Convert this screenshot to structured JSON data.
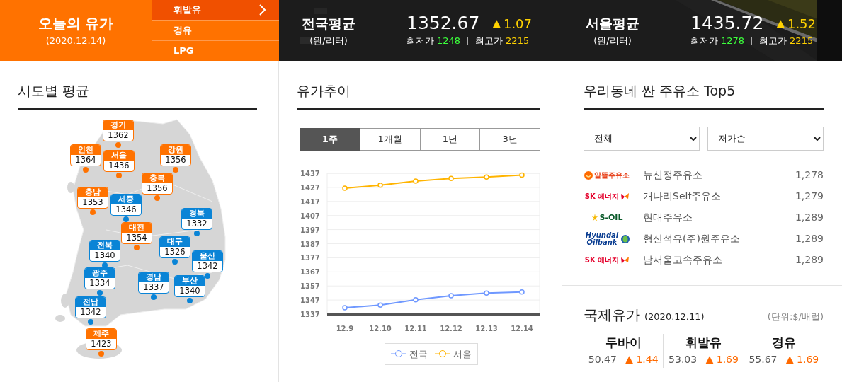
{
  "header": {
    "title": "오늘의 유가",
    "date": "(2020.12.14)",
    "fuels": [
      {
        "label": "휘발유",
        "selected": true
      },
      {
        "label": "경유",
        "selected": false
      },
      {
        "label": "LPG",
        "selected": false
      }
    ],
    "averages": [
      {
        "title": "전국평균",
        "unit": "(원/리터)",
        "price": "1352.67",
        "arrow": "▲",
        "change": "1.07",
        "min_label": "최저가",
        "min": "1248",
        "max_label": "최고가",
        "max": "2215"
      },
      {
        "title": "서울평균",
        "unit": "(원/리터)",
        "price": "1435.72",
        "arrow": "▲",
        "change": "1.52",
        "min_label": "최저가",
        "min": "1278",
        "max_label": "최고가",
        "max": "2215"
      }
    ]
  },
  "regional": {
    "title": "시도별 평균",
    "regions": [
      {
        "name": "경기",
        "price": "1362",
        "color": "#ff7200"
      },
      {
        "name": "인천",
        "price": "1364",
        "color": "#ff7200"
      },
      {
        "name": "서울",
        "price": "1436",
        "color": "#ff7200"
      },
      {
        "name": "강원",
        "price": "1356",
        "color": "#ff7200"
      },
      {
        "name": "충북",
        "price": "1356",
        "color": "#ff7200"
      },
      {
        "name": "충남",
        "price": "1353",
        "color": "#ff7200"
      },
      {
        "name": "세종",
        "price": "1346",
        "color": "#0a84d6"
      },
      {
        "name": "경북",
        "price": "1332",
        "color": "#0a84d6"
      },
      {
        "name": "대전",
        "price": "1354",
        "color": "#ff7200"
      },
      {
        "name": "전북",
        "price": "1340",
        "color": "#0a84d6"
      },
      {
        "name": "대구",
        "price": "1326",
        "color": "#0a84d6"
      },
      {
        "name": "울산",
        "price": "1342",
        "color": "#0a84d6"
      },
      {
        "name": "광주",
        "price": "1334",
        "color": "#0a84d6"
      },
      {
        "name": "경남",
        "price": "1337",
        "color": "#0a84d6"
      },
      {
        "name": "부산",
        "price": "1340",
        "color": "#0a84d6"
      },
      {
        "name": "전남",
        "price": "1342",
        "color": "#0a84d6"
      },
      {
        "name": "제주",
        "price": "1423",
        "color": "#ff7200"
      }
    ]
  },
  "trend": {
    "title": "유가추이",
    "tabs": [
      {
        "label": "1주",
        "selected": true
      },
      {
        "label": "1개월",
        "selected": false
      },
      {
        "label": "1년",
        "selected": false
      },
      {
        "label": "3년",
        "selected": false
      }
    ],
    "chart_data": {
      "type": "line",
      "grid": true,
      "legend": true,
      "categories": [
        "12.9",
        "12.10",
        "12.11",
        "12.12",
        "12.13",
        "12.14"
      ],
      "ylim": [
        1337,
        1437
      ],
      "yticks": [
        1337,
        1347,
        1357,
        1367,
        1377,
        1387,
        1397,
        1407,
        1417,
        1427,
        1437
      ],
      "series": [
        {
          "name": "전국",
          "color": "#6f98ff",
          "marker": "circle",
          "values": [
            1341.5,
            1343.4,
            1347.2,
            1350.1,
            1352.0,
            1352.7
          ]
        },
        {
          "name": "서울",
          "color": "#ffb400",
          "marker": "circle",
          "values": [
            1426.5,
            1428.6,
            1431.5,
            1433.4,
            1434.4,
            1435.7
          ]
        }
      ]
    }
  },
  "stations": {
    "title": "우리동네 싼 주유소 Top5",
    "filters": [
      {
        "value": "전체"
      },
      {
        "value": "저가순"
      }
    ],
    "items": [
      {
        "kind": "alddeul",
        "logo": "알뜰주유소",
        "name": "뉴신정주유소",
        "price": "1,278"
      },
      {
        "kind": "sk",
        "logo": "SK 에너지",
        "name": "개나리Self주유소",
        "price": "1,279"
      },
      {
        "kind": "soil",
        "logo": "S-OIL",
        "name": "현대주유소",
        "price": "1,289"
      },
      {
        "kind": "hyundai",
        "logo": "Hyundai Oilbank",
        "name": "형산석유(주)원주유소",
        "price": "1,289"
      },
      {
        "kind": "sk",
        "logo": "SK 에너지",
        "name": "남서울고속주유소",
        "price": "1,289"
      }
    ]
  },
  "international": {
    "title": "국제유가",
    "date": "(2020.12.11)",
    "unit": "(단위:$/배럴)",
    "items": [
      {
        "name": "두바이",
        "price": "50.47",
        "arrow": "▲",
        "change": "1.44"
      },
      {
        "name": "휘발유",
        "price": "53.03",
        "arrow": "▲",
        "change": "1.69"
      },
      {
        "name": "경유",
        "price": "55.67",
        "arrow": "▲",
        "change": "1.69"
      }
    ]
  }
}
